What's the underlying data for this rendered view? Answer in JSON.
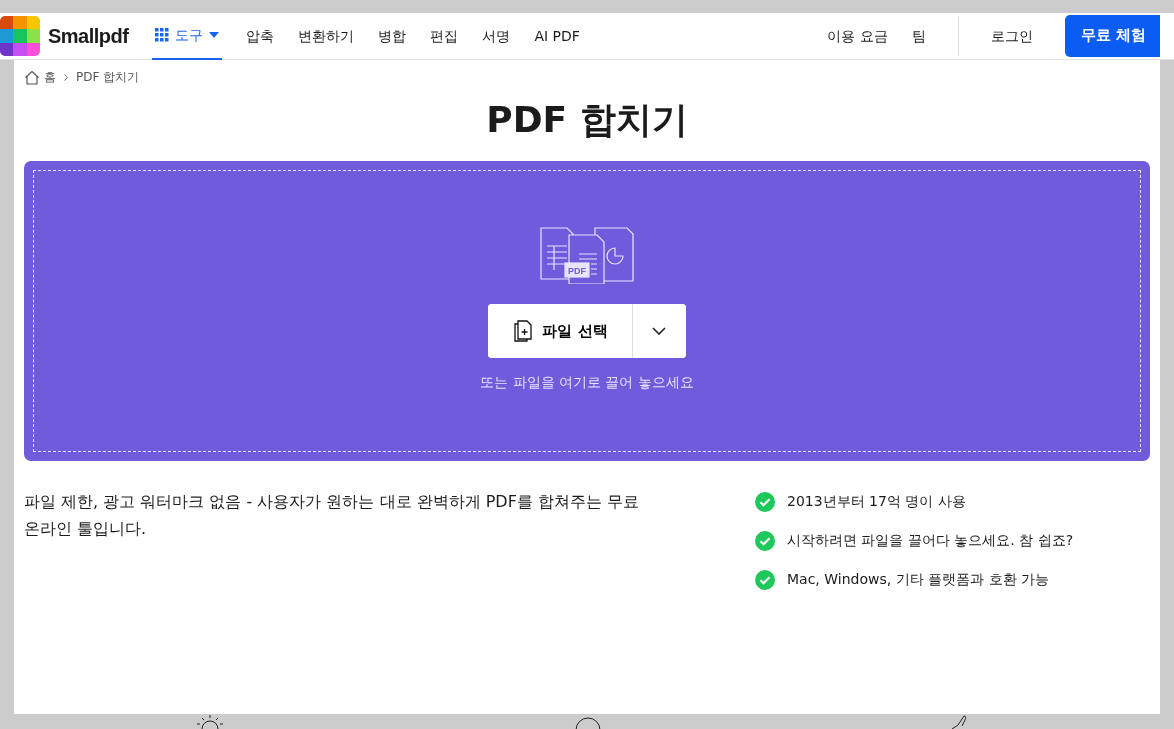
{
  "header": {
    "logo": "Smallpdf",
    "tools_menu": {
      "label": "도구",
      "selected": true
    },
    "nav_items": [
      "압축",
      "변환하기",
      "병합",
      "편집",
      "서명",
      "AI PDF"
    ],
    "right_links": [
      "이용 요금",
      "팀"
    ],
    "login": "로그인",
    "cta": "무료 체험"
  },
  "breadcrumb": [
    "홈",
    "PDF 합치기"
  ],
  "title": "PDF 합치기",
  "dropzone": {
    "illustration_label": "PDF",
    "choose_button": "파일 선택",
    "hint": "또는 파일을 여기로 끌어 놓으세요"
  },
  "description": "파일 제한, 광고 워터마크 없음 - 사용자가 원하는 대로 완벽하게 PDF를 합쳐주는 무료 온라인 툴입니다.",
  "features": [
    "2013년부터 17억 명이 사용",
    "시작하려면 파일을 끌어다 놓으세요. 참 쉽죠?",
    "Mac, Windows, 기타 플랫폼과 호환 가능"
  ]
}
